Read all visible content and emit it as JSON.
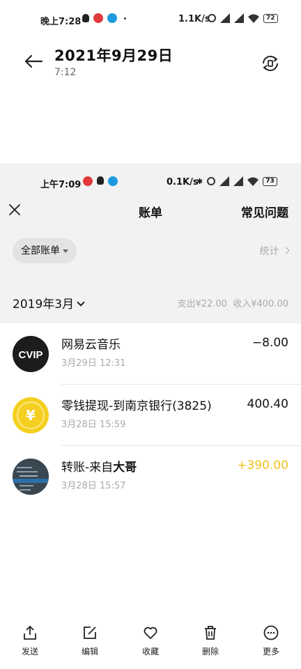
{
  "status_bar": {
    "time": "晚上7:28",
    "network_speed": "1.1K/s",
    "battery": "72"
  },
  "viewer": {
    "title": "2021年9月29日",
    "subtitle": "7:12",
    "back_icon": "arrow-left-icon",
    "rotate_icon": "rotate-icon"
  },
  "screenshot": {
    "status_bar": {
      "time": "上午7:09",
      "network_speed": "0.1K/s",
      "battery": "73"
    },
    "nav": {
      "close_icon": "close-icon",
      "title": "账单",
      "faq": "常见问题"
    },
    "filter": {
      "label": "全部账单",
      "stats": "统计"
    },
    "month": {
      "label": "2019年3月",
      "expense": "支出¥22.00",
      "income": "收入¥400.00"
    },
    "transactions": [
      {
        "name": "网易云音乐",
        "name_bold": "",
        "date": "3月29日 12:31",
        "amount": "−8.00",
        "amount_color": "#111111",
        "avatar": "cvip-logo"
      },
      {
        "name": "零钱提现-到南京银行(3825)",
        "name_bold": "",
        "date": "3月28日 15:59",
        "amount": "400.40",
        "amount_color": "#111111",
        "avatar": "yen-coin-icon"
      },
      {
        "name": "转账-来自",
        "name_bold": "大哥",
        "date": "3月28日 15:57",
        "amount": "+390.00",
        "amount_color": "#F0C21B",
        "avatar": "user-avatar"
      }
    ]
  },
  "actions": [
    {
      "label": "发送",
      "icon": "share-icon"
    },
    {
      "label": "编辑",
      "icon": "edit-icon"
    },
    {
      "label": "收藏",
      "icon": "heart-icon"
    },
    {
      "label": "删除",
      "icon": "trash-icon"
    },
    {
      "label": "更多",
      "icon": "more-icon"
    }
  ]
}
